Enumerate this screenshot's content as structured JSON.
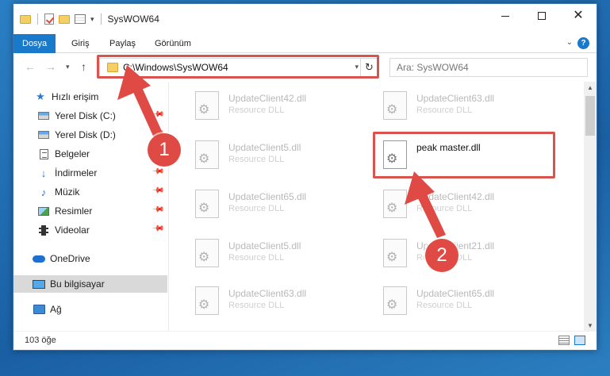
{
  "window": {
    "title": "SysWOW64"
  },
  "ribbon": {
    "tabs": [
      "Dosya",
      "Giriş",
      "Paylaş",
      "Görünüm"
    ],
    "help": "?"
  },
  "nav": {
    "address": "C:\\Windows\\SysWOW64",
    "search_placeholder": "Ara: SysWOW64"
  },
  "sidebar": {
    "items": [
      {
        "label": "Hızlı erişim",
        "icon": "star-icon"
      },
      {
        "label": "Yerel Disk (C:)",
        "icon": "drive-icon",
        "pinned": true
      },
      {
        "label": "Yerel Disk (D:)",
        "icon": "drive-icon",
        "pinned": true
      },
      {
        "label": "Belgeler",
        "icon": "documents-icon",
        "pinned": true
      },
      {
        "label": "İndirmeler",
        "icon": "downloads-icon",
        "pinned": true
      },
      {
        "label": "Müzik",
        "icon": "music-icon",
        "pinned": true
      },
      {
        "label": "Resimler",
        "icon": "pictures-icon",
        "pinned": true
      },
      {
        "label": "Videolar",
        "icon": "videos-icon",
        "pinned": true
      },
      {
        "label": "OneDrive",
        "icon": "onedrive-icon"
      },
      {
        "label": "Bu bilgisayar",
        "icon": "this-pc-icon",
        "selected": true
      },
      {
        "label": "Ağ",
        "icon": "network-icon"
      }
    ]
  },
  "files": [
    {
      "name": "UpdateClient42.dll",
      "type": "Resource DLL"
    },
    {
      "name": "UpdateClient63.dll",
      "type": "Resource DLL"
    },
    {
      "name": "UpdateClient5.dll",
      "type": "Resource DLL"
    },
    {
      "name": "peak master.dll",
      "type": ""
    },
    {
      "name": "UpdateClient65.dll",
      "type": "Resource DLL"
    },
    {
      "name": "UpdateClient42.dll",
      "type": "Resource DLL"
    },
    {
      "name": "UpdateClient5.dll",
      "type": "Resource DLL"
    },
    {
      "name": "UpdateClient21.dll",
      "type": "Resource DLL"
    },
    {
      "name": "UpdateClient63.dll",
      "type": "Resource DLL"
    },
    {
      "name": "UpdateClient65.dll",
      "type": "Resource DLL"
    }
  ],
  "status": {
    "count": "103 öğe"
  },
  "annotations": {
    "step1": "1",
    "step2": "2",
    "color": "#df4a44"
  }
}
